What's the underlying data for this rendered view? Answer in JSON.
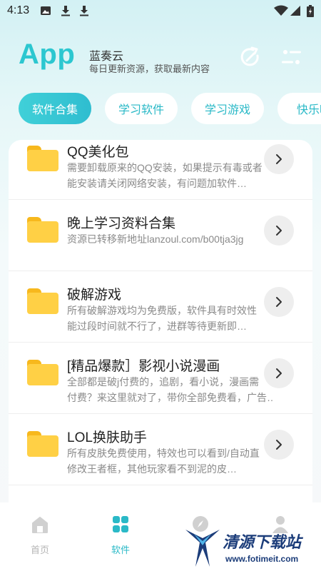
{
  "status_bar": {
    "time": "4:13",
    "icons": [
      "image-icon",
      "download-icon",
      "download-icon",
      "wifi-icon",
      "signal-icon",
      "battery-icon"
    ]
  },
  "header": {
    "logo": "App",
    "app_name": "蓝奏云",
    "subtitle": "每日更新资源，获取最新内容",
    "refresh_icon": "refresh-icon",
    "filter_icon": "filter-icon",
    "accent_color": "#2cc7d0"
  },
  "tabs": [
    {
      "label": "软件合集",
      "active": true
    },
    {
      "label": "学习软件",
      "active": false
    },
    {
      "label": "学习游戏",
      "active": false
    },
    {
      "label": "快乐吃",
      "active": false
    }
  ],
  "list": {
    "items": [
      {
        "title": "QQ美化包",
        "desc_line1": "需要卸载原来的QQ安装，如果提示有毒或者",
        "desc_line2": "能安装请关闭网络安装，有问题加软件…"
      },
      {
        "title": "晚上学习资料合集",
        "desc_line1": "资源已转移新地址lanzoul.com/b00tja3jg",
        "desc_line2": ""
      },
      {
        "title": "破解游戏",
        "desc_line1": "所有破解游戏均为免费版，软件具有时效性",
        "desc_line2": "能过段时间就不行了，进群等待更新即…"
      },
      {
        "title": "[精品爆款］影视小说漫画",
        "desc_line1": "全部都是破j付费的，追剧，看小说，漫画需",
        "desc_line2": "付费？来这里就对了，带你全部免费看，广告…"
      },
      {
        "title": "LOL换肤助手",
        "desc_line1": "所有皮肤免费使用，特效也可以看到/自动直",
        "desc_line2": "修改王者框，其他玩家看不到泥的皮…"
      }
    ],
    "folder_color": "#ffd045"
  },
  "bottom_nav": {
    "items": [
      {
        "label": "首页",
        "icon": "home-icon",
        "active": false
      },
      {
        "label": "软件",
        "icon": "grid-icon",
        "active": true
      },
      {
        "label": "",
        "icon": "compass-icon",
        "active": false
      },
      {
        "label": "",
        "icon": "user-icon",
        "active": false
      }
    ]
  },
  "watermark": {
    "text": "清源下载站",
    "url": "www.fotimeit.com"
  }
}
